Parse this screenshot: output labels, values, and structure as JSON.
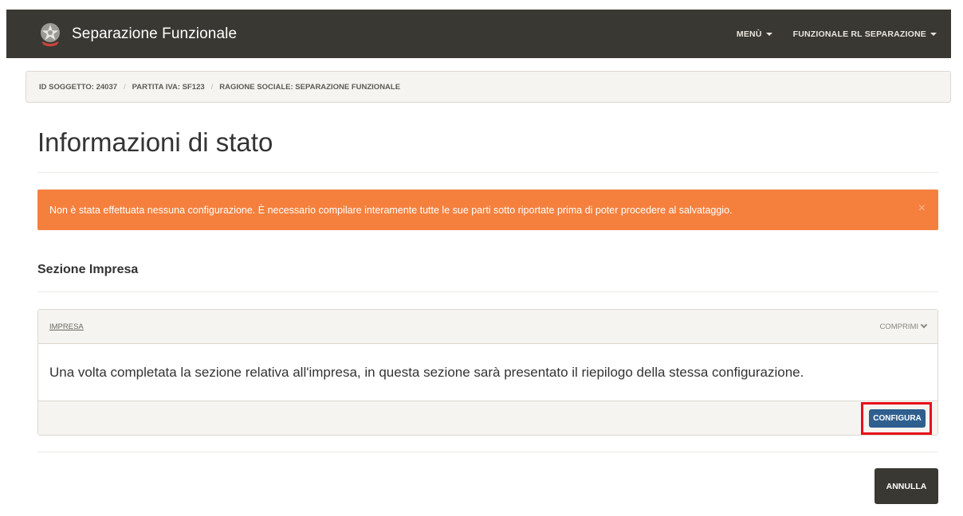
{
  "navbar": {
    "brand_title": "Separazione Funzionale",
    "menu_label": "MENÙ",
    "user_label": "FUNZIONALE RL SEPARAZIONE"
  },
  "breadcrumb": {
    "items": [
      "ID SOGGETTO: 24037",
      "PARTITA IVA: SF123",
      "RAGIONE SOCIALE: SEPARAZIONE FUNZIONALE"
    ]
  },
  "page": {
    "title": "Informazioni di stato"
  },
  "alert": {
    "message": "Non è stata effettuata nessuna configurazione. È necessario compilare interamente tutte le sue parti sotto riportate prima di poter procedere al salvataggio.",
    "close_symbol": "×",
    "color": "#f5803e"
  },
  "section": {
    "title": "Sezione Impresa"
  },
  "panel": {
    "header_link": "IMPRESA",
    "collapse_label": "COMPRIMI",
    "body_text": "Una volta completata la sezione relativa all'impresa, in questa sezione sarà presentato il riepilogo della stessa configurazione.",
    "configure_label": "CONFIGURA"
  },
  "footer": {
    "cancel_label": "ANNULLA"
  },
  "colors": {
    "navbar": "#3a3832",
    "primary_button": "#2e5f8f",
    "highlight": "#e8101a"
  }
}
